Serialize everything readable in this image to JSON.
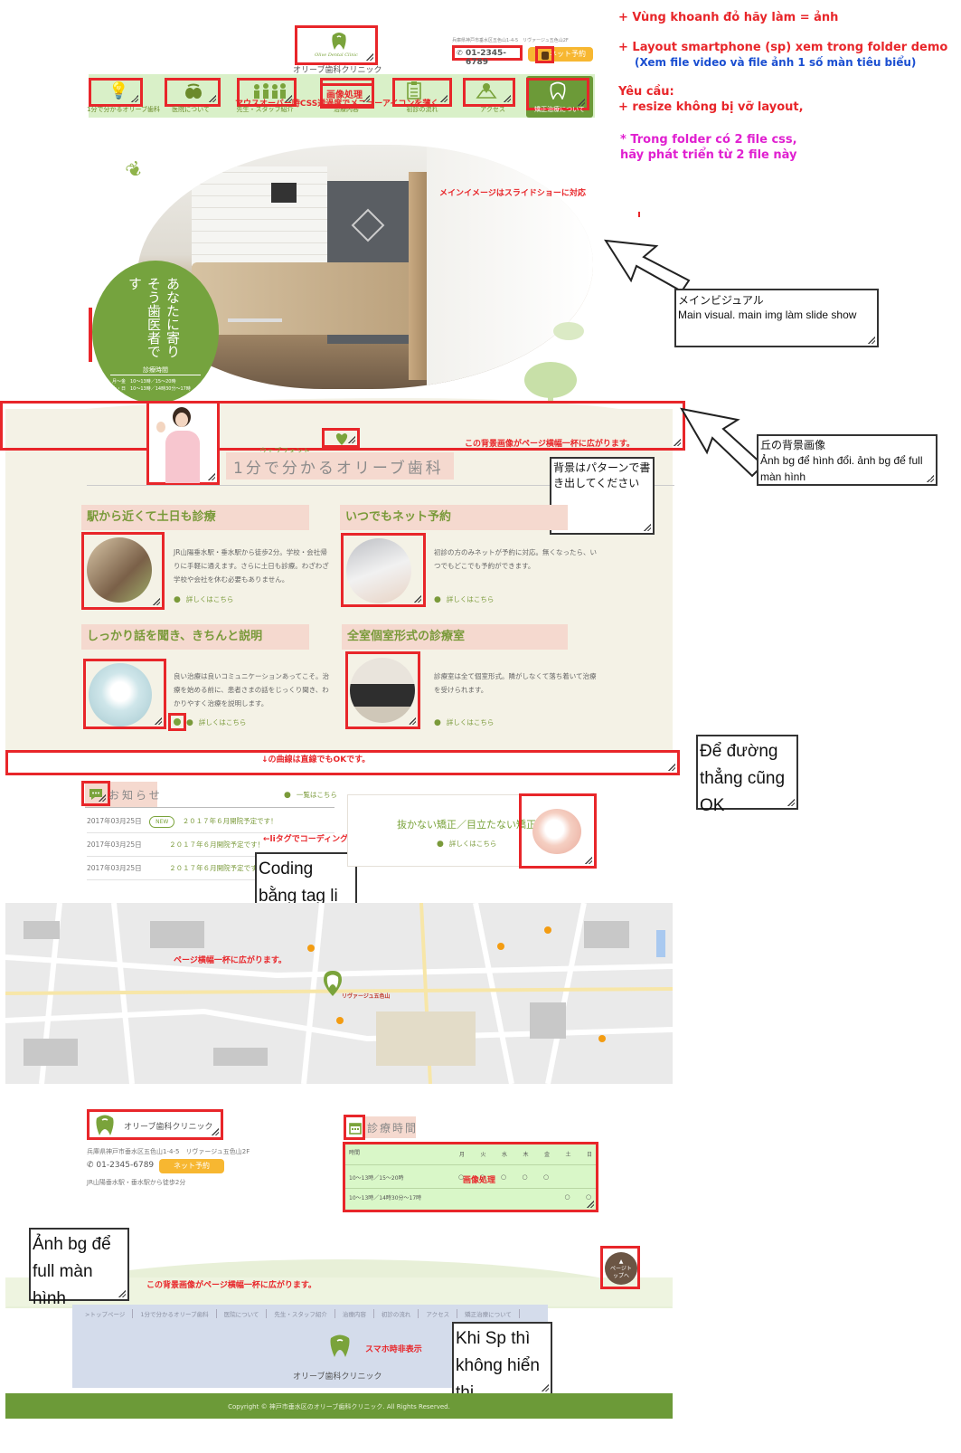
{
  "instructions": {
    "line1": "+ Vùng khoanh đỏ hãy làm = ảnh",
    "line2": "+ Layout smartphone (sp) xem trong folder demo",
    "line3": "(Xem file video và file ảnh 1 số màn tiêu biểu)",
    "line4": "Yêu cầu:",
    "line5": "+ resize không bị vỡ layout,",
    "line6": "* Trong folder có 2 file css,",
    "line7": "hãy phát triển từ 2 file này"
  },
  "header": {
    "logo_text": "Olive Dental Clinic",
    "clinic_name": "オリーブ歯科クリニック",
    "address": "兵庫県神戸市垂水区五色山1-4-5　リヴァージュ五色山2F",
    "phone": "01-2345-6789",
    "net_reserve": "ネット予約"
  },
  "nav": {
    "items": [
      {
        "label": "1分で分かるオリーブ歯科"
      },
      {
        "label": "医院について"
      },
      {
        "label": "先生・スタッフ紹介"
      },
      {
        "label": "治療内容"
      },
      {
        "label": "初診の流れ"
      },
      {
        "label": "アクセス"
      },
      {
        "label": "矯正治療について"
      }
    ],
    "note": "マウスオーバー時CSS透過度でメニューアイコンを薄く",
    "image_note": "画像処理"
  },
  "main_visual": {
    "note": "メインイメージはスライドショーに対応",
    "tagline": "あなたに寄りそう歯医者です",
    "hours_label": "診療時間",
    "hours_line1": "月～金　10～13時／15～20時",
    "hours_line2": "土・日　10～13時／14時30分～17時",
    "callout_ja": "メインビジュアル",
    "callout_vi": "Main visual. main img làm slide show"
  },
  "hill": {
    "note": "この背景画像がページ横幅一杯に広がります。",
    "callout_title": "丘の背景画像",
    "callout_body": "Ảnh bg để hình đổi. ảnh bg để full màn hình"
  },
  "intro": {
    "webfont_note": "ウェブフォント",
    "title": "1分で分かるオリーブ歯科",
    "pattern_note": "背景はパターンで書き出してください"
  },
  "features": [
    {
      "title": "駅から近くて土日も診療",
      "text": "JR山陽垂水駅・垂水駅から徒歩2分。学校・会社帰りに手軽に通えます。さらに土日も診療。わざわざ学校や会社を休む必要もありません。",
      "more": "詳しくはこちら"
    },
    {
      "title": "いつでもネット予約",
      "text": "初診の方のみネットが予約に対応。無くなったら、いつでもどこでも予約ができます。",
      "more": "詳しくはこちら"
    },
    {
      "title": "しっかり話を聞き、きちんと説明",
      "text": "良い治療は良いコミュニケーションあってこそ。治療を始める前に、患者さまの話をじっくり聞き、わかりやすく治療を説明します。",
      "more": "詳しくはこちら"
    },
    {
      "title": "全室個室形式の診療室",
      "text": "診療室は全て個室形式。隣がしなくて落ち着いて治療を受けられます。",
      "more": "詳しくはこちら"
    }
  ],
  "curve": {
    "note": "↓の曲線は直線でもOKです。",
    "callout": "Để đường thẳng cũng OK"
  },
  "news": {
    "title": "お知らせ",
    "list_link": "一覧はこちら",
    "new_badge": "NEW",
    "items": [
      {
        "date": "2017年03月25日",
        "text": "２０１７年６月開院予定です！"
      },
      {
        "date": "2017年03月25日",
        "text": "２０１７年６月開院予定です！"
      },
      {
        "date": "2017年03月25日",
        "text": "２０１７年６月開院予定です！"
      }
    ],
    "li_note": "←liタグでコーディング",
    "callout": "Coding bằng tag li"
  },
  "banner": {
    "text": "抜かない矯正／目立たない矯正",
    "more": "詳しくはこちら"
  },
  "map": {
    "note": "ページ横幅一杯に広がります。",
    "pin_label": "リヴァージュ五色山"
  },
  "footer_info": {
    "clinic_name": "オリーブ歯科クリニック",
    "address": "兵庫県神戸市垂水区五色山1-4-5　リヴァージュ五色山2F",
    "phone": "01-2345-6789",
    "net_reserve": "ネット予約",
    "access": "JR山陽垂水駅・垂水駅から徒歩2分"
  },
  "hours_table": {
    "title": "診療時間",
    "header_label": "時間",
    "days": [
      "月",
      "火",
      "水",
      "木",
      "金",
      "土",
      "日"
    ],
    "rows": [
      {
        "time": "10～13時／15～20時",
        "marks": [
          "○",
          "○",
          "○",
          "○",
          "○",
          "",
          ""
        ]
      },
      {
        "time": "10～13時／14時30分～17時",
        "marks": [
          "",
          "",
          "",
          "",
          "",
          "○",
          "○"
        ]
      }
    ],
    "image_note": "画像処理"
  },
  "bottom": {
    "bg_callout": "Ảnh bg để full màn hình",
    "bg_note": "この背景画像がページ横幅一杯に広がります。",
    "page_top": "ページトップへ",
    "footer_nav": [
      ">トップページ",
      "1分で分かるオリーブ歯科",
      "医院について",
      "先生・スタッフ紹介",
      "治療内容",
      "初診の流れ",
      "アクセス",
      "矯正治療について"
    ],
    "sp_note": "スマホ時非表示",
    "sp_callout": "Khi Sp thì không hiển thị",
    "copyright": "Copyright © 神戸市垂水区のオリーブ歯科クリニック. All Rights Reserved."
  },
  "colors": {
    "accent_green": "#7aa33b",
    "salmon": "#f5d9cf",
    "red": "#e8262a",
    "yellow": "#f7b731"
  }
}
